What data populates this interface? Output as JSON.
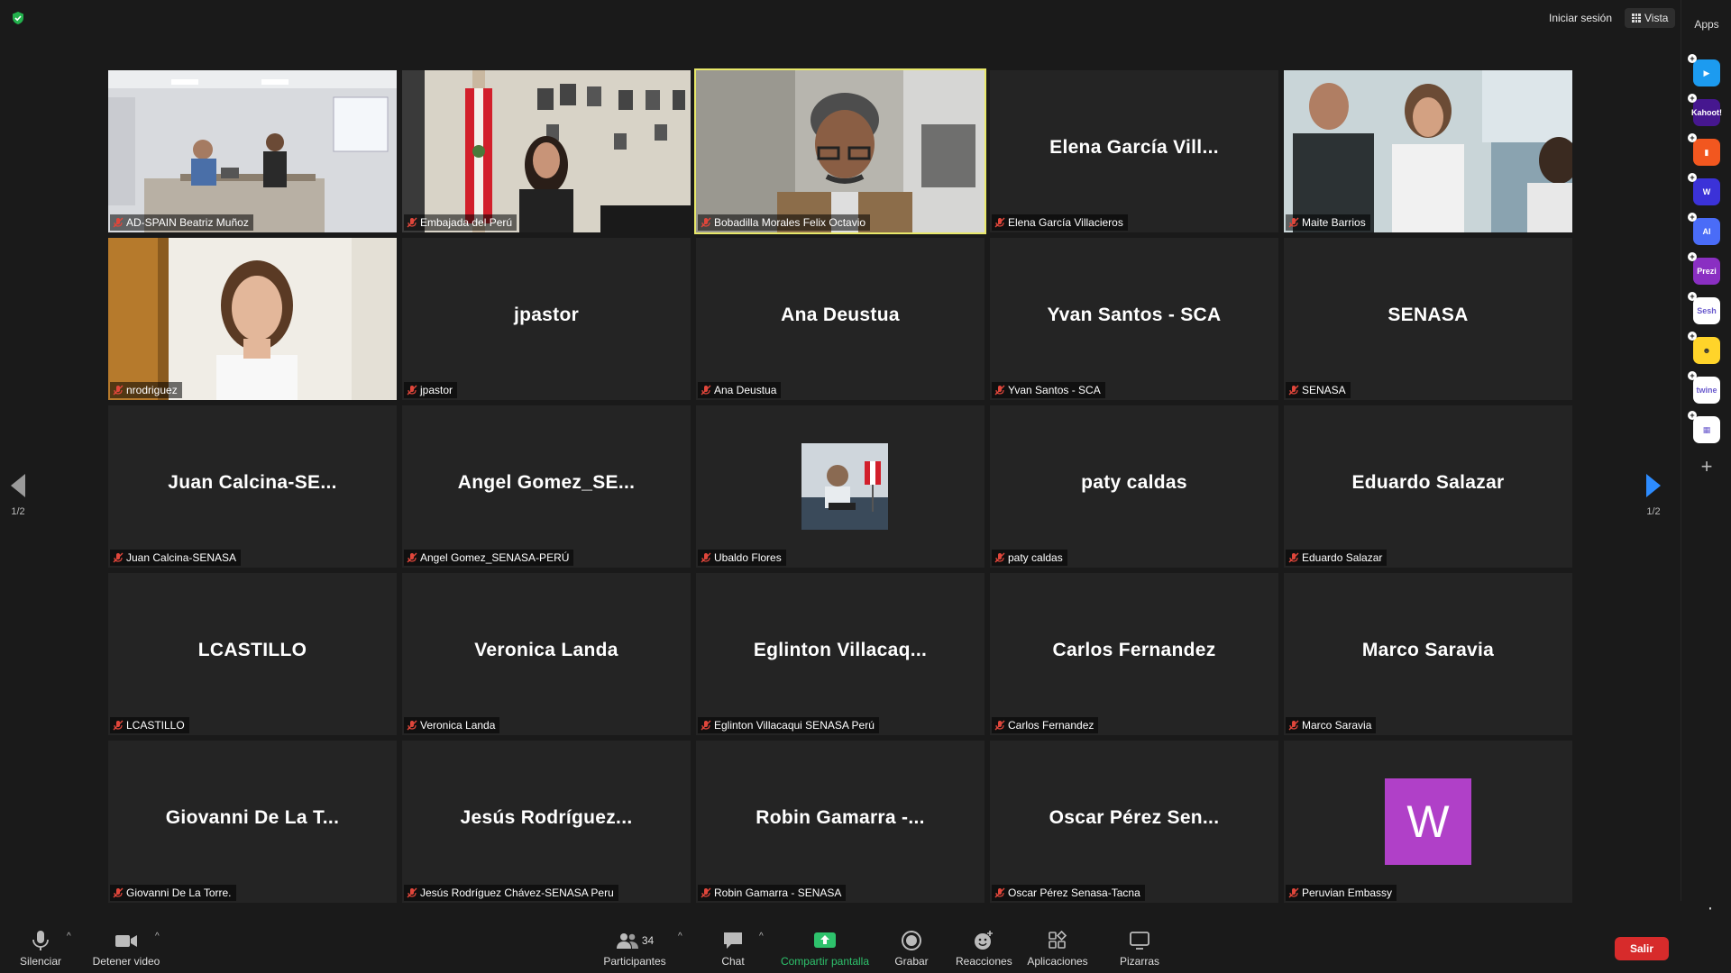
{
  "top_bar": {
    "sign_in_label": "Iniciar sesión",
    "view_label": "Vista"
  },
  "apps_panel": {
    "title": "Apps",
    "apps": [
      {
        "name": "app-play",
        "color": "#1c9bf0",
        "text": "▶"
      },
      {
        "name": "app-kahoot",
        "color": "#46178f",
        "text": "Kahoot!"
      },
      {
        "name": "app-orange",
        "color": "#f2571f",
        "text": "▮"
      },
      {
        "name": "app-w",
        "color": "#3b32d8",
        "text": "W"
      },
      {
        "name": "app-ai",
        "color": "#4a6cf7",
        "text": "AI"
      },
      {
        "name": "app-prezi",
        "color": "#8a2fc2",
        "text": "Prezi"
      },
      {
        "name": "app-sesh",
        "color": "#ffffff",
        "text": "Sesh"
      },
      {
        "name": "app-emoji",
        "color": "#ffd42a",
        "text": "☻"
      },
      {
        "name": "app-twine",
        "color": "#ffffff",
        "text": "twine"
      },
      {
        "name": "app-blocks",
        "color": "#ffffff",
        "text": "▦"
      }
    ]
  },
  "pagination": {
    "left_page": "1/2",
    "right_page": "1/2"
  },
  "tiles": [
    {
      "display": "",
      "name": "AD-SPAIN Beatriz Muñoz",
      "type": "video",
      "scene": "office"
    },
    {
      "display": "",
      "name": "Embajada del Perú",
      "type": "video",
      "scene": "embassy"
    },
    {
      "display": "",
      "name": "Bobadilla Morales Felix Octavio",
      "type": "video",
      "scene": "man",
      "active": true
    },
    {
      "display": "Elena García Vill...",
      "name": "Elena García Villacieros",
      "type": "name"
    },
    {
      "display": "",
      "name": "Maite Barrios",
      "type": "video",
      "scene": "lab"
    },
    {
      "display": "",
      "name": "nrodriguez",
      "type": "video",
      "scene": "woman"
    },
    {
      "display": "jpastor",
      "name": "jpastor",
      "type": "name"
    },
    {
      "display": "Ana Deustua",
      "name": "Ana Deustua",
      "type": "name"
    },
    {
      "display": "Yvan Santos - SCA",
      "name": "Yvan Santos - SCA",
      "type": "name"
    },
    {
      "display": "SENASA",
      "name": "SENASA",
      "type": "name"
    },
    {
      "display": "Juan  Calcina-SE...",
      "name": "Juan Calcina-SENASA",
      "type": "name"
    },
    {
      "display": "Angel  Gomez_SE...",
      "name": "Angel Gomez_SENASA-PERÚ",
      "type": "name"
    },
    {
      "display": "",
      "name": "Ubaldo Flores",
      "type": "avatar-photo"
    },
    {
      "display": "paty caldas",
      "name": "paty caldas",
      "type": "name"
    },
    {
      "display": "Eduardo Salazar",
      "name": "Eduardo Salazar",
      "type": "name"
    },
    {
      "display": "LCASTILLO",
      "name": "LCASTILLO",
      "type": "name"
    },
    {
      "display": "Veronica Landa",
      "name": "Veronica Landa",
      "type": "name"
    },
    {
      "display": "Eglinton  Villacaq...",
      "name": "Eglinton Villacaqui SENASA Perú",
      "type": "name"
    },
    {
      "display": "Carlos Fernandez",
      "name": "Carlos Fernandez",
      "type": "name"
    },
    {
      "display": "Marco Saravia",
      "name": "Marco Saravia",
      "type": "name"
    },
    {
      "display": "Giovanni De La T...",
      "name": "Giovanni De La Torre.",
      "type": "name"
    },
    {
      "display": "Jesús  Rodríguez...",
      "name": "Jesús Rodríguez Chávez-SENASA Peru",
      "type": "name"
    },
    {
      "display": "Robin Gamarra -...",
      "name": "Robin Gamarra - SENASA",
      "type": "name"
    },
    {
      "display": "Oscar Pérez Sen...",
      "name": "Oscar Pérez Senasa-Tacna",
      "type": "name"
    },
    {
      "display": "W",
      "name": "Peruvian Embassy",
      "type": "avatar-letter"
    }
  ],
  "toolbar": {
    "mute_label": "Silenciar",
    "video_label": "Detener video",
    "participants_label": "Participantes",
    "participants_count": "34",
    "chat_label": "Chat",
    "share_label": "Compartir pantalla",
    "record_label": "Grabar",
    "reactions_label": "Reacciones",
    "apps_label": "Aplicaciones",
    "whiteboards_label": "Pizarras",
    "leave_label": "Salir"
  },
  "colors": {
    "accent_blue": "#2d8cff",
    "active_speaker": "#e8e86a",
    "share_green": "#2ec26c",
    "leave_red": "#d72b2b",
    "muted_red": "#e0463b"
  }
}
